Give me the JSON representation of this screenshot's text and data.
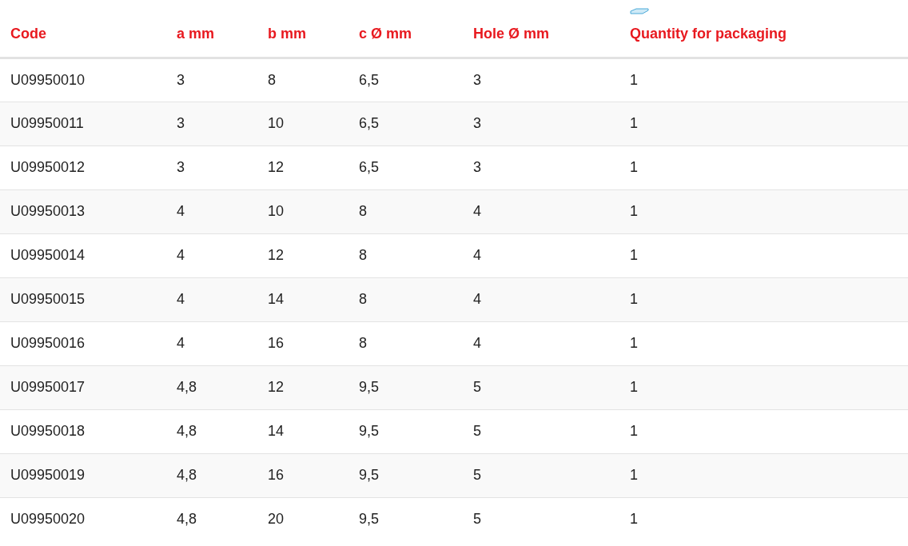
{
  "table": {
    "columns": [
      "Code",
      "a mm",
      "b mm",
      "c Ø mm",
      "Hole Ø mm",
      "Quantity for packaging"
    ],
    "rows": [
      [
        "U09950010",
        "3",
        "8",
        "6,5",
        "3",
        "1"
      ],
      [
        "U09950011",
        "3",
        "10",
        "6,5",
        "3",
        "1"
      ],
      [
        "U09950012",
        "3",
        "12",
        "6,5",
        "3",
        "1"
      ],
      [
        "U09950013",
        "4",
        "10",
        "8",
        "4",
        "1"
      ],
      [
        "U09950014",
        "4",
        "12",
        "8",
        "4",
        "1"
      ],
      [
        "U09950015",
        "4",
        "14",
        "8",
        "4",
        "1"
      ],
      [
        "U09950016",
        "4",
        "16",
        "8",
        "4",
        "1"
      ],
      [
        "U09950017",
        "4,8",
        "12",
        "9,5",
        "5",
        "1"
      ],
      [
        "U09950018",
        "4,8",
        "14",
        "9,5",
        "5",
        "1"
      ],
      [
        "U09950019",
        "4,8",
        "16",
        "9,5",
        "5",
        "1"
      ],
      [
        "U09950020",
        "4,8",
        "20",
        "9,5",
        "5",
        "1"
      ]
    ]
  }
}
